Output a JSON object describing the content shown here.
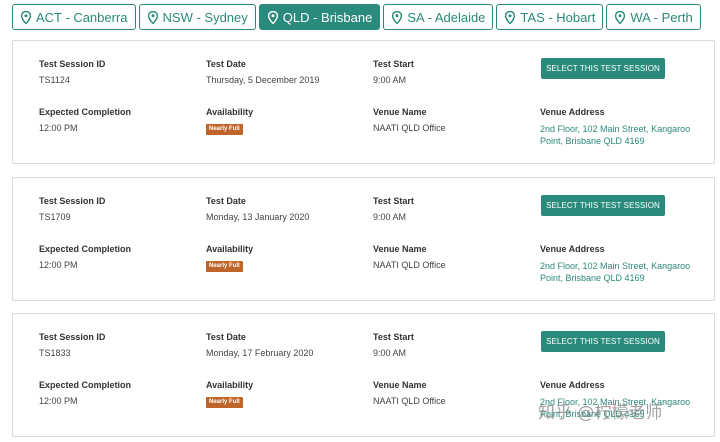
{
  "tabs": [
    {
      "label": "ACT - Canberra",
      "active": false
    },
    {
      "label": "NSW - Sydney",
      "active": false
    },
    {
      "label": "QLD - Brisbane",
      "active": true
    },
    {
      "label": "SA - Adelaide",
      "active": false
    },
    {
      "label": "TAS - Hobart",
      "active": false
    },
    {
      "label": "WA - Perth",
      "active": false
    }
  ],
  "field_labels": {
    "session_id": "Test Session ID",
    "date": "Test Date",
    "start": "Test Start",
    "completion": "Expected Completion",
    "availability": "Availability",
    "venue": "Venue Name",
    "address": "Venue Address"
  },
  "select_button_label": "SELECT THIS TEST SESSION",
  "sessions": [
    {
      "id": "TS1124",
      "date": "Thursday, 5 December 2019",
      "start": "9:00 AM",
      "completion": "12:00 PM",
      "availability": "Nearly Full",
      "venue": "NAATI QLD Office",
      "address": "2nd Floor, 102 Main Street, Kangaroo Point, Brisbane QLD 4169"
    },
    {
      "id": "TS1709",
      "date": "Monday, 13 January 2020",
      "start": "9:00 AM",
      "completion": "12:00 PM",
      "availability": "Nearly Full",
      "venue": "NAATI QLD Office",
      "address": "2nd Floor, 102 Main Street, Kangaroo Point, Brisbane QLD 4169"
    },
    {
      "id": "TS1833",
      "date": "Monday, 17 February 2020",
      "start": "9:00 AM",
      "completion": "12:00 PM",
      "availability": "Nearly Full",
      "venue": "NAATI QLD Office",
      "address": "2nd Floor, 102 Main Street, Kangaroo Point, Brisbane QLD 4169"
    }
  ],
  "watermark": "知乎 @柠檬老师",
  "colors": {
    "accent": "#2a8a7b",
    "badge": "#c0652a"
  }
}
